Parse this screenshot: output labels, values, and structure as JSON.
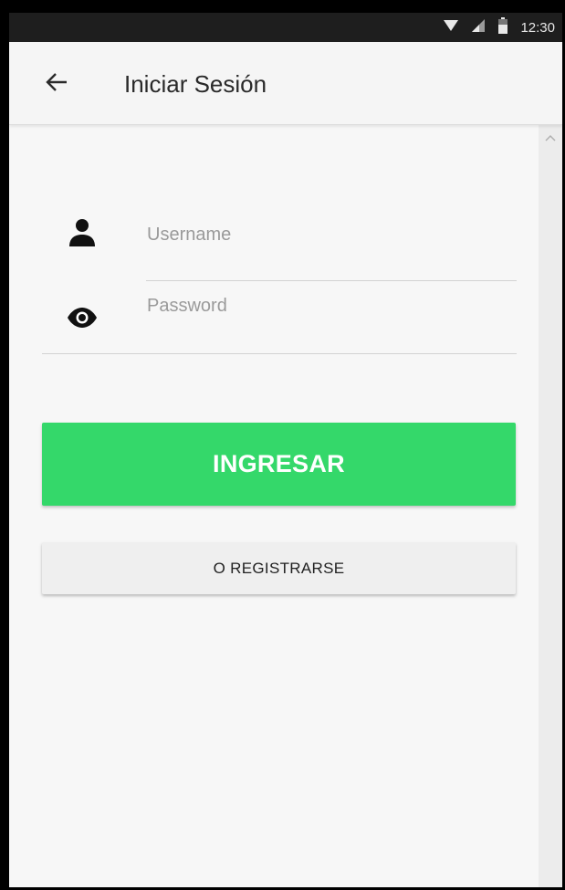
{
  "status_bar": {
    "time": "12:30",
    "icons": [
      "wifi-icon",
      "signal-icon",
      "battery-icon"
    ]
  },
  "app_bar": {
    "back_icon": "arrow-left-icon",
    "title": "Iniciar Sesión"
  },
  "form": {
    "username": {
      "icon": "person-icon",
      "placeholder": "Username",
      "value": ""
    },
    "password": {
      "icon": "eye-icon",
      "placeholder": "Password",
      "value": ""
    }
  },
  "buttons": {
    "login_label": "INGRESAR",
    "register_label": "O REGISTRARSE"
  },
  "colors": {
    "primary_button": "#34d86a",
    "secondary_button": "#efefef",
    "status_bar": "#1e1e1e",
    "app_bar": "#f5f5f5"
  }
}
